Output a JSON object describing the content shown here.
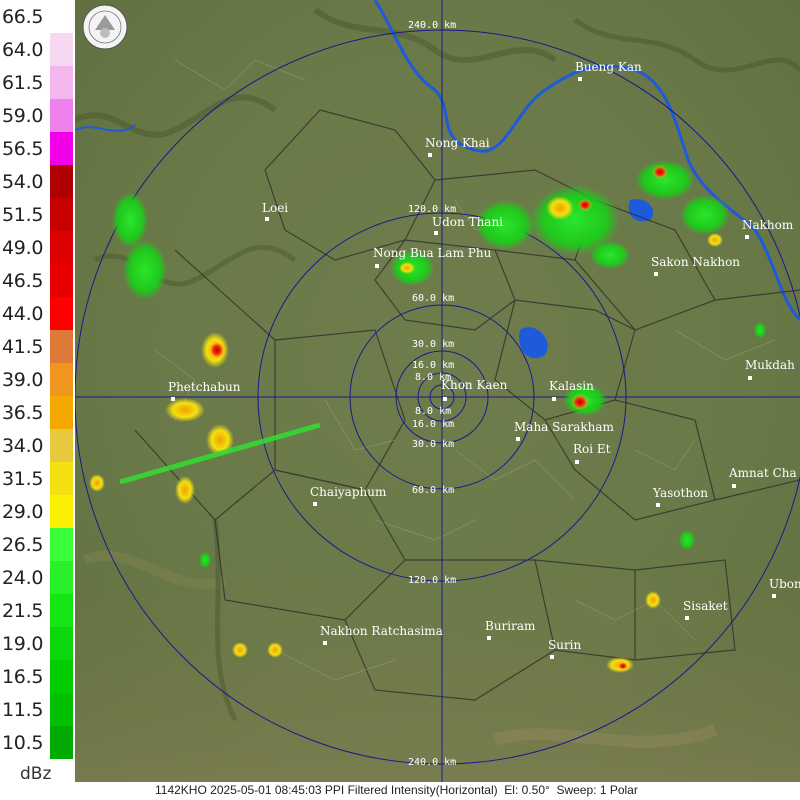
{
  "legend": {
    "unit": "dBz",
    "entries": [
      {
        "label": "66.5",
        "color": "#ffffff"
      },
      {
        "label": "64.0",
        "color": "#f6d8f2"
      },
      {
        "label": "61.5",
        "color": "#f3b6ee"
      },
      {
        "label": "59.0",
        "color": "#f080ec"
      },
      {
        "label": "56.5",
        "color": "#f000e8"
      },
      {
        "label": "54.0",
        "color": "#b00000"
      },
      {
        "label": "51.5",
        "color": "#c80000"
      },
      {
        "label": "49.0",
        "color": "#dc0000"
      },
      {
        "label": "46.5",
        "color": "#e80000"
      },
      {
        "label": "44.0",
        "color": "#ff0000"
      },
      {
        "label": "41.5",
        "color": "#e07838"
      },
      {
        "label": "39.0",
        "color": "#f0961e"
      },
      {
        "label": "36.5",
        "color": "#f4a800"
      },
      {
        "label": "34.0",
        "color": "#e8c83c"
      },
      {
        "label": "31.5",
        "color": "#f4e010"
      },
      {
        "label": "29.0",
        "color": "#f8f000"
      },
      {
        "label": "26.5",
        "color": "#3cff3c"
      },
      {
        "label": "24.0",
        "color": "#28f028"
      },
      {
        "label": "21.5",
        "color": "#14e614"
      },
      {
        "label": "19.0",
        "color": "#0cd60c"
      },
      {
        "label": "16.5",
        "color": "#00cc00"
      },
      {
        "label": "11.5",
        "color": "#00c000"
      },
      {
        "label": "10.5",
        "color": "#00aa00"
      }
    ]
  },
  "range_rings": {
    "labels_top": [
      "240.0 km",
      "120.0 km",
      "60.0 km",
      "30.0 km",
      "16.0 km",
      "8.0 km"
    ],
    "labels_bottom": [
      "8.0 km",
      "16.0 km",
      "30.0 km",
      "60.0 km",
      "120.0 km",
      "240.0 km"
    ]
  },
  "cities": [
    {
      "name": "Bueng Kan"
    },
    {
      "name": "Nong Khai"
    },
    {
      "name": "Loei"
    },
    {
      "name": "Udon Thani"
    },
    {
      "name": "Nakhom"
    },
    {
      "name": "Nong Bua Lam Phu"
    },
    {
      "name": "Sakon Nakhon"
    },
    {
      "name": "Mukdah"
    },
    {
      "name": "Phetchabun"
    },
    {
      "name": "Khon Kaen"
    },
    {
      "name": "Kalasin"
    },
    {
      "name": "Maha Sarakham"
    },
    {
      "name": "Roi Et"
    },
    {
      "name": "Amnat Cha"
    },
    {
      "name": "Chaiyaphum"
    },
    {
      "name": "Yasothon"
    },
    {
      "name": "Ubon"
    },
    {
      "name": "Sisaket"
    },
    {
      "name": "Buriram"
    },
    {
      "name": "Nakhon Ratchasima"
    },
    {
      "name": "Surin"
    }
  ],
  "footer": "1142KHO 2025-05-01 08:45:03 PPI Filtered Intensity(Horizontal)  El: 0.50°  Sweep: 1 Polar",
  "icons": {
    "logo": "department-seal-logo"
  }
}
